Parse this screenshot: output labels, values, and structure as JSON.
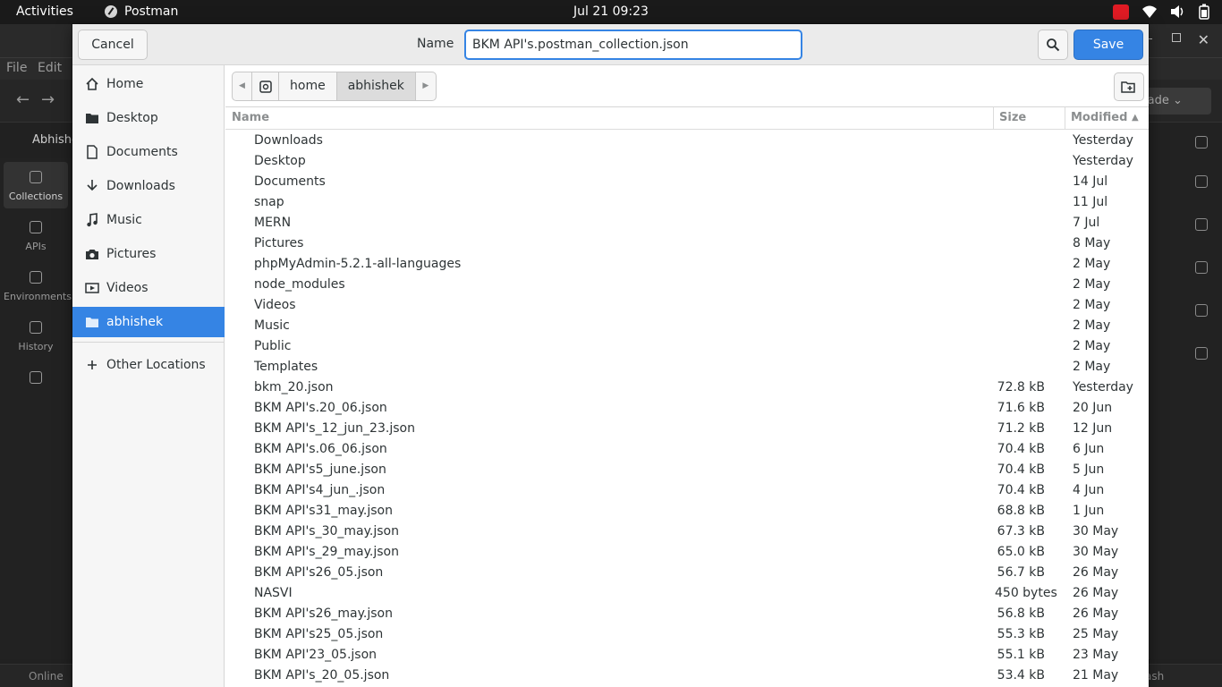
{
  "topbar": {
    "activities": "Activities",
    "app_name": "Postman",
    "clock": "Jul 21  09:23"
  },
  "postman": {
    "menu": {
      "file": "File",
      "edit": "Edit"
    },
    "upgrade": "grade",
    "workspace": "Abhishe",
    "nav_left": [
      {
        "label": "Collections"
      },
      {
        "label": "APIs"
      },
      {
        "label": "Environments"
      },
      {
        "label": "History"
      }
    ],
    "status": {
      "online": "Online",
      "trash": "ash"
    }
  },
  "dialog": {
    "cancel_label": "Cancel",
    "name_label": "Name",
    "filename": "BKM API's.postman_collection.json",
    "save_label": "Save",
    "places": [
      {
        "label": "Home",
        "icon": "home-icon"
      },
      {
        "label": "Desktop",
        "icon": "folder-icon"
      },
      {
        "label": "Documents",
        "icon": "document-icon"
      },
      {
        "label": "Downloads",
        "icon": "download-icon"
      },
      {
        "label": "Music",
        "icon": "music-icon"
      },
      {
        "label": "Pictures",
        "icon": "camera-icon"
      },
      {
        "label": "Videos",
        "icon": "video-icon"
      },
      {
        "label": "abhishek",
        "icon": "folder-icon",
        "selected": true
      }
    ],
    "other_locations": "Other Locations",
    "path": [
      "home",
      "abhishek"
    ],
    "columns": {
      "name": "Name",
      "size": "Size",
      "modified": "Modified"
    },
    "files": [
      {
        "name": "Downloads",
        "size": "",
        "modified": "Yesterday"
      },
      {
        "name": "Desktop",
        "size": "",
        "modified": "Yesterday"
      },
      {
        "name": "Documents",
        "size": "",
        "modified": "14 Jul"
      },
      {
        "name": "snap",
        "size": "",
        "modified": "11 Jul"
      },
      {
        "name": "MERN",
        "size": "",
        "modified": "7 Jul"
      },
      {
        "name": "Pictures",
        "size": "",
        "modified": "8 May"
      },
      {
        "name": "phpMyAdmin-5.2.1-all-languages",
        "size": "",
        "modified": "2 May"
      },
      {
        "name": "node_modules",
        "size": "",
        "modified": "2 May"
      },
      {
        "name": "Videos",
        "size": "",
        "modified": "2 May"
      },
      {
        "name": "Music",
        "size": "",
        "modified": "2 May"
      },
      {
        "name": "Public",
        "size": "",
        "modified": "2 May"
      },
      {
        "name": "Templates",
        "size": "",
        "modified": "2 May"
      },
      {
        "name": "bkm_20.json",
        "size": "72.8 kB",
        "modified": "Yesterday"
      },
      {
        "name": "BKM API's.20_06.json",
        "size": "71.6 kB",
        "modified": "20 Jun"
      },
      {
        "name": "BKM API's_12_jun_23.json",
        "size": "71.2 kB",
        "modified": "12 Jun"
      },
      {
        "name": "BKM API's.06_06.json",
        "size": "70.4 kB",
        "modified": "6 Jun"
      },
      {
        "name": "BKM API's5_june.json",
        "size": "70.4 kB",
        "modified": "5 Jun"
      },
      {
        "name": "BKM API's4_jun_.json",
        "size": "70.4 kB",
        "modified": "4 Jun"
      },
      {
        "name": "BKM API's31_may.json",
        "size": "68.8 kB",
        "modified": "1 Jun"
      },
      {
        "name": "BKM API's_30_may.json",
        "size": "67.3 kB",
        "modified": "30 May"
      },
      {
        "name": "BKM API's_29_may.json",
        "size": "65.0 kB",
        "modified": "30 May"
      },
      {
        "name": "BKM API's26_05.json",
        "size": "56.7 kB",
        "modified": "26 May"
      },
      {
        "name": "NASVI",
        "size": "450 bytes",
        "modified": "26 May"
      },
      {
        "name": "BKM API's26_may.json",
        "size": "56.8 kB",
        "modified": "26 May"
      },
      {
        "name": "BKM API's25_05.json",
        "size": "55.3 kB",
        "modified": "25 May"
      },
      {
        "name": "BKM API'23_05.json",
        "size": "55.1 kB",
        "modified": "23 May"
      },
      {
        "name": "BKM API's_20_05.json",
        "size": "53.4 kB",
        "modified": "21 May"
      }
    ]
  },
  "colors": {
    "accent": "#3584e4",
    "topbar": "#1a1a1a"
  }
}
